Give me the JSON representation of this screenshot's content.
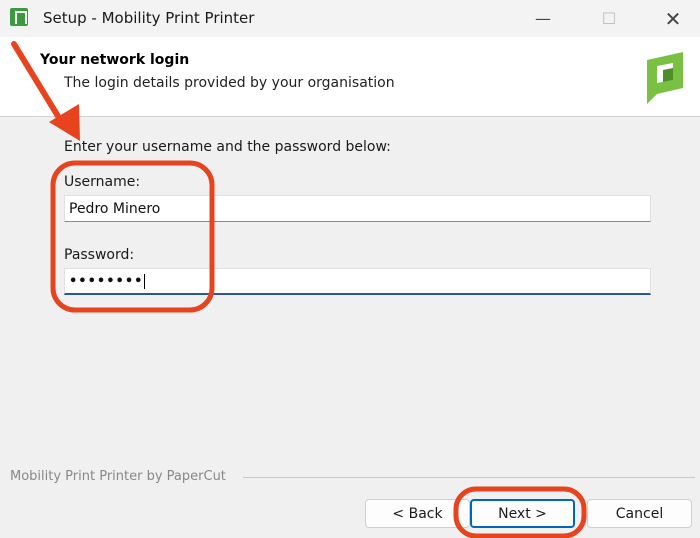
{
  "window": {
    "title": "Setup - Mobility Print Printer",
    "minimize": "—",
    "maximize": "☐",
    "close": "✕"
  },
  "header": {
    "title": "Your network login",
    "subtitle": "The login details provided by your organisation"
  },
  "form": {
    "instructions": "Enter your username and the password below:",
    "username_label": "Username:",
    "username_value": "Pedro Minero",
    "password_label": "Password:",
    "password_value": "••••••••"
  },
  "footer": {
    "brand": "Mobility Print Printer by PaperCut",
    "back_label": "< Back",
    "next_label": "Next >",
    "cancel_label": "Cancel"
  },
  "colors": {
    "annotation": "#e8431f",
    "accent": "#0067c0",
    "logo_green": "#7ac143"
  }
}
